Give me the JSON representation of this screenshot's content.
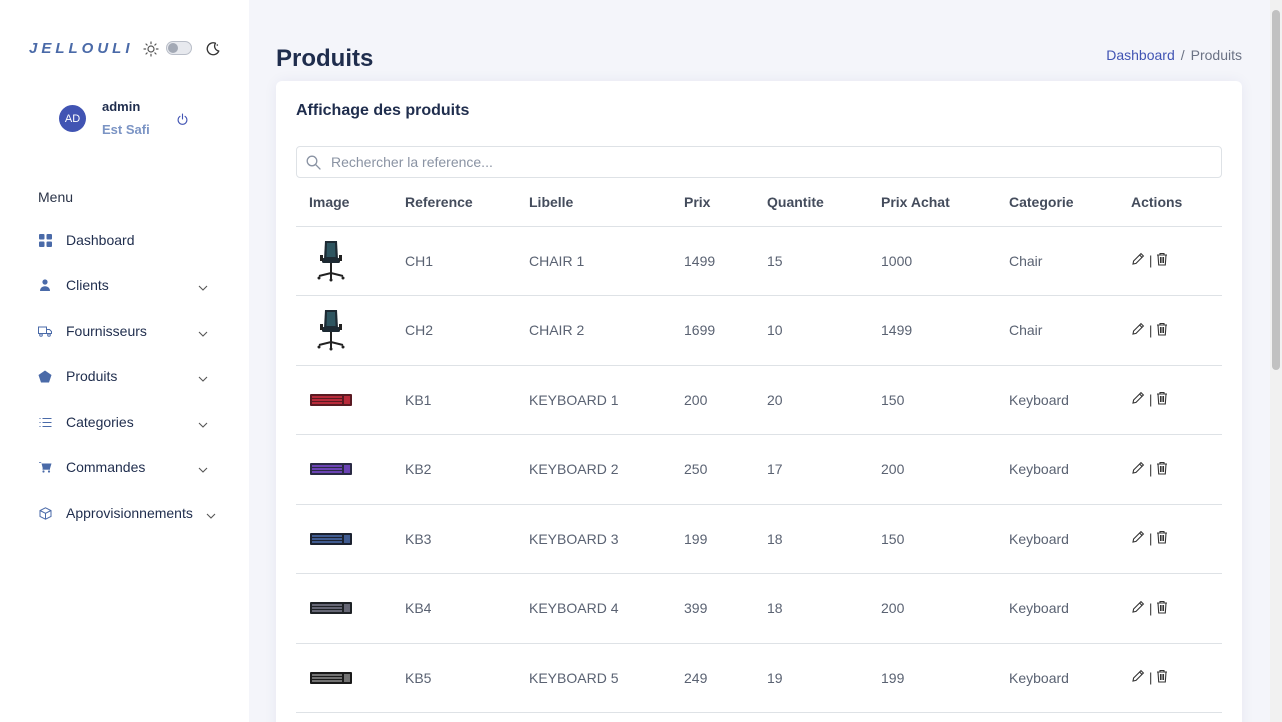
{
  "brand": "JELLOULI",
  "user": {
    "initials": "AD",
    "name": "admin",
    "org": "Est Safi"
  },
  "menu": {
    "title": "Menu",
    "items": [
      {
        "label": "Dashboard",
        "icon": "grid-icon",
        "has_submenu": false
      },
      {
        "label": "Clients",
        "icon": "person-icon",
        "has_submenu": true
      },
      {
        "label": "Fournisseurs",
        "icon": "truck-icon",
        "has_submenu": true
      },
      {
        "label": "Produits",
        "icon": "pentagon-icon",
        "has_submenu": true
      },
      {
        "label": "Categories",
        "icon": "list-icon",
        "has_submenu": true
      },
      {
        "label": "Commandes",
        "icon": "cart-icon",
        "has_submenu": true
      },
      {
        "label": "Approvisionnements",
        "icon": "box-icon",
        "has_submenu": true
      }
    ]
  },
  "page": {
    "title": "Produits",
    "breadcrumb": [
      "Dashboard",
      "/",
      "Produits"
    ]
  },
  "card": {
    "title": "Affichage des produits",
    "search_placeholder": "Rechercher la reference..."
  },
  "table": {
    "columns": [
      "Image",
      "Reference",
      "Libelle",
      "Prix",
      "Quantite",
      "Prix Achat",
      "Categorie",
      "Actions"
    ],
    "rows": [
      {
        "image": "chair-image",
        "reference": "CH1",
        "libelle": "CHAIR 1",
        "prix": "1499",
        "quantite": "15",
        "prix_achat": "1000",
        "categorie": "Chair"
      },
      {
        "image": "chair-image",
        "reference": "CH2",
        "libelle": "CHAIR 2",
        "prix": "1699",
        "quantite": "10",
        "prix_achat": "1499",
        "categorie": "Chair"
      },
      {
        "image": "keyboard-image",
        "reference": "KB1",
        "libelle": "KEYBOARD 1",
        "prix": "200",
        "quantite": "20",
        "prix_achat": "150",
        "categorie": "Keyboard"
      },
      {
        "image": "keyboard-image",
        "reference": "KB2",
        "libelle": "KEYBOARD 2",
        "prix": "250",
        "quantite": "17",
        "prix_achat": "200",
        "categorie": "Keyboard"
      },
      {
        "image": "keyboard-image",
        "reference": "KB3",
        "libelle": "KEYBOARD 3",
        "prix": "199",
        "quantite": "18",
        "prix_achat": "150",
        "categorie": "Keyboard"
      },
      {
        "image": "keyboard-image",
        "reference": "KB4",
        "libelle": "KEYBOARD 4",
        "prix": "399",
        "quantite": "18",
        "prix_achat": "200",
        "categorie": "Keyboard"
      },
      {
        "image": "keyboard-image",
        "reference": "KB5",
        "libelle": "KEYBOARD 5",
        "prix": "249",
        "quantite": "19",
        "prix_achat": "199",
        "categorie": "Keyboard"
      }
    ],
    "action_separator": "|"
  },
  "colors": {
    "accent": "#4154b3",
    "brand": "#4a6aa8",
    "heading": "#1f2d4d",
    "background": "#f4f5fa"
  }
}
